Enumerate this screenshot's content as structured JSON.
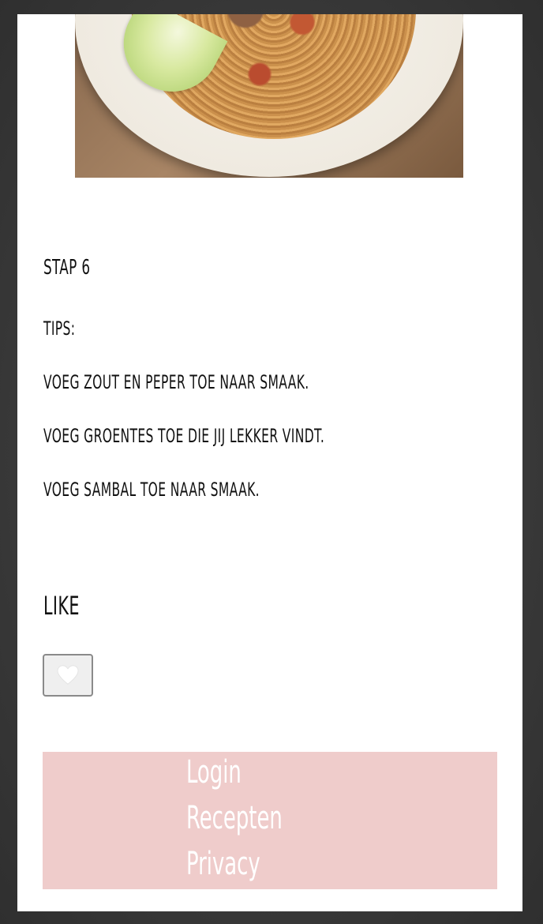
{
  "step": {
    "title": "Stap 6"
  },
  "tips": {
    "label": "Tips:",
    "items": [
      "Voeg zout en peper toe naar smaak.",
      "Voeg groentes toe die jij lekker vindt.",
      "Voeg sambal toe naar smaak."
    ]
  },
  "like": {
    "heading": "Like",
    "button_icon": "heart-icon"
  },
  "footer": {
    "links": [
      "Login",
      "Recepten",
      "Privacy"
    ],
    "background": "#efcccb",
    "text_color": "#ffffff"
  },
  "image": {
    "subject": "noodle-bowl-photo"
  }
}
